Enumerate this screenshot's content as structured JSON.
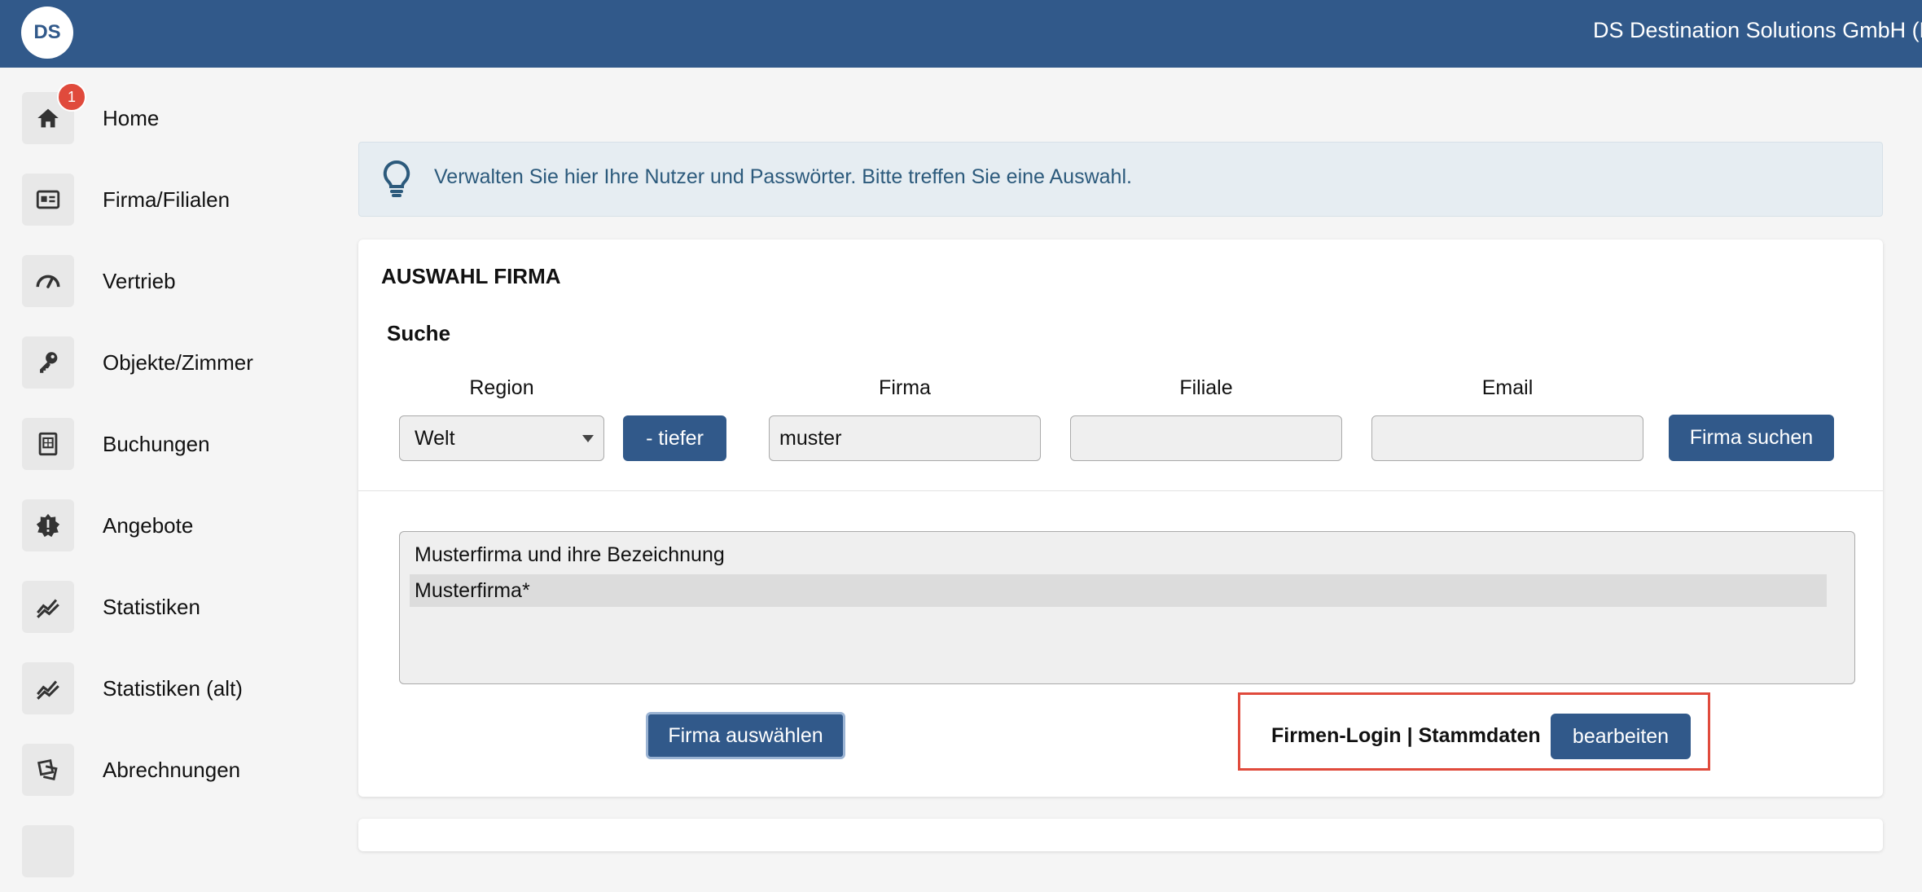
{
  "header": {
    "logo_text": "DS",
    "company_name": "DS Destination Solutions GmbH (RU"
  },
  "sidebar": {
    "items": [
      {
        "label": "Home",
        "icon": "home-icon",
        "badge": "1"
      },
      {
        "label": "Firma/Filialen",
        "icon": "id-card-icon"
      },
      {
        "label": "Vertrieb",
        "icon": "gauge-icon"
      },
      {
        "label": "Objekte/Zimmer",
        "icon": "key-icon"
      },
      {
        "label": "Buchungen",
        "icon": "calendar-icon"
      },
      {
        "label": "Angebote",
        "icon": "offer-badge-icon"
      },
      {
        "label": "Statistiken",
        "icon": "chart-line-icon"
      },
      {
        "label": "Statistiken (alt)",
        "icon": "chart-line-icon"
      },
      {
        "label": "Abrechnungen",
        "icon": "receipts-icon"
      }
    ]
  },
  "info": {
    "icon": "lightbulb-icon",
    "text": "Verwalten Sie hier Ihre Nutzer und Passwörter. Bitte treffen Sie eine Auswahl."
  },
  "card": {
    "title": "AUSWAHL FIRMA",
    "search_title": "Suche",
    "labels": {
      "region": "Region",
      "firma": "Firma",
      "filiale": "Filiale",
      "email": "Email"
    },
    "region_value": "Welt",
    "deeper_button": "- tiefer",
    "firma_value": "muster",
    "filiale_value": "",
    "email_value": "",
    "search_button": "Firma suchen",
    "list": {
      "header": "Musterfirma und ihre Bezeichnung",
      "options": [
        "Musterfirma*"
      ]
    },
    "select_button": "Firma auswählen",
    "login_label": "Firmen-Login | Stammdaten",
    "edit_button": "bearbeiten"
  },
  "colors": {
    "primary": "#31598a",
    "highlight": "#e04a3c",
    "info_bg": "#e6edf2",
    "info_text": "#2c5a7c"
  }
}
